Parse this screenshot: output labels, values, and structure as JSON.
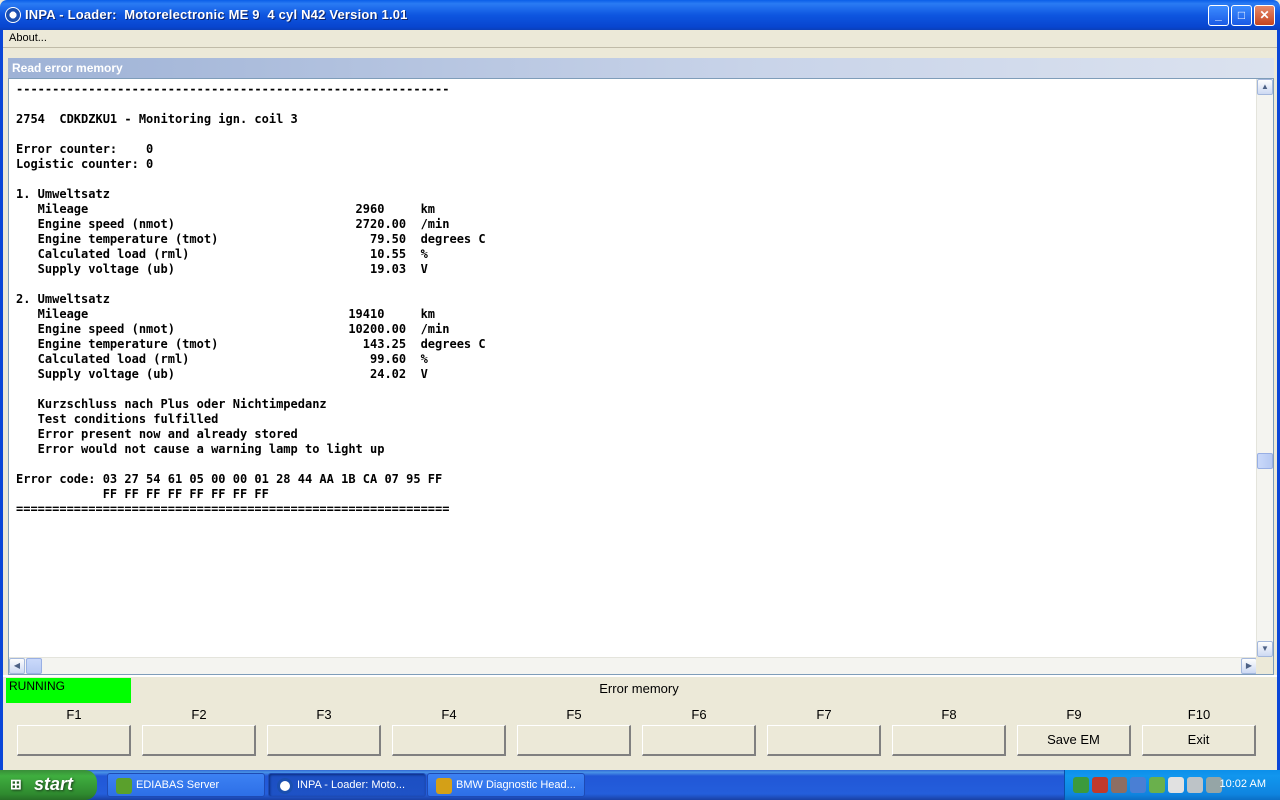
{
  "window": {
    "title": "INPA - Loader:  Motorelectronic ME 9  4 cyl N42 Version 1.01",
    "min_glyph": "_",
    "max_glyph": "□",
    "close_glyph": "✕"
  },
  "menu": {
    "about": "About..."
  },
  "panel": {
    "caption": "Read error memory"
  },
  "output": {
    "lines": [
      "------------------------------------------------------------",
      "",
      "2754  CDKDZKU1 - Monitoring ign. coil 3",
      "",
      "Error counter:    0",
      "Logistic counter: 0",
      "",
      "1. Umweltsatz",
      "   Mileage                                     2960     km",
      "   Engine speed (nmot)                         2720.00  /min",
      "   Engine temperature (tmot)                     79.50  degrees C",
      "   Calculated load (rml)                         10.55  %",
      "   Supply voltage (ub)                           19.03  V",
      "",
      "2. Umweltsatz",
      "   Mileage                                    19410     km",
      "   Engine speed (nmot)                        10200.00  /min",
      "   Engine temperature (tmot)                    143.25  degrees C",
      "   Calculated load (rml)                         99.60  %",
      "   Supply voltage (ub)                           24.02  V",
      "",
      "   Kurzschluss nach Plus oder Nichtimpedanz",
      "   Test conditions fulfilled",
      "   Error present now and already stored",
      "   Error would not cause a warning lamp to light up",
      "",
      "Error code: 03 27 54 61 05 00 00 01 28 44 AA 1B CA 07 95 FF",
      "            FF FF FF FF FF FF FF FF",
      "============================================================"
    ]
  },
  "status": {
    "running": "RUNNING",
    "title": "Error memory",
    "running_color": "#00ff00"
  },
  "fkeys": [
    {
      "key": "F1",
      "label": ""
    },
    {
      "key": "F2",
      "label": ""
    },
    {
      "key": "F3",
      "label": ""
    },
    {
      "key": "F4",
      "label": ""
    },
    {
      "key": "F5",
      "label": ""
    },
    {
      "key": "F6",
      "label": ""
    },
    {
      "key": "F7",
      "label": ""
    },
    {
      "key": "F8",
      "label": ""
    },
    {
      "key": "F9",
      "label": "Save EM"
    },
    {
      "key": "F10",
      "label": "Exit"
    }
  ],
  "taskbar": {
    "start": "start",
    "tasks": [
      {
        "label": "EDIABAS Server",
        "icon": "ediabas-icon",
        "color": "#5aa02c"
      },
      {
        "label": "INPA - Loader:  Moto...",
        "icon": "inpa-icon",
        "color": "#1a4fb0"
      },
      {
        "label": "BMW Diagnostic Head...",
        "icon": "bmw-head-icon",
        "color": "#d4a017"
      }
    ],
    "clock": "10:02 AM"
  }
}
